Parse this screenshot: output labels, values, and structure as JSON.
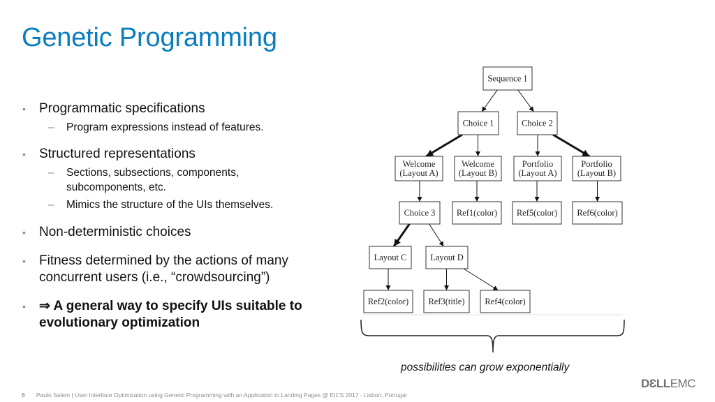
{
  "slide": {
    "title": "Genetic Programming",
    "page_number": "6",
    "footer": "Paulo Salem | User Interface Optimization using Genetic Programming with an Application to Landing Pages  @  EICS 2017 - Lisbon, Portugal",
    "logo": {
      "dell": "DƐLL",
      "emc": "EMC"
    },
    "accent_color": "#0a7dbd"
  },
  "bullets": [
    {
      "text": "Programmatic specifications",
      "sub": [
        "Program expressions instead of features."
      ]
    },
    {
      "text": "Structured representations",
      "sub": [
        "Sections, subsections, components, subcomponents, etc.",
        "Mimics the structure of the UIs themselves."
      ]
    },
    {
      "text": "Non-deterministic choices",
      "sub": []
    },
    {
      "text": "Fitness determined by the actions of many concurrent users (i.e., “crowdsourcing”)",
      "sub": []
    },
    {
      "text": "⇒ A general way to specify UIs suitable to evolutionary optimization",
      "sub": [],
      "bold": true
    }
  ],
  "bullet_glyph": "•",
  "sub_bullet_glyph": "–",
  "diagram": {
    "nodes": {
      "seq1": [
        "Sequence 1"
      ],
      "choice1": [
        "Choice 1"
      ],
      "choice2": [
        "Choice 2"
      ],
      "welcomeA": [
        "Welcome",
        "(Layout A)"
      ],
      "welcomeB": [
        "Welcome",
        "(Layout B)"
      ],
      "portfolioA": [
        "Portfolio",
        "(Layout A)"
      ],
      "portfolioB": [
        "Portfolio",
        "(Layout B)"
      ],
      "choice3": [
        "Choice 3"
      ],
      "ref1": [
        "Ref1(color)"
      ],
      "ref5": [
        "Ref5(color)"
      ],
      "ref6": [
        "Ref6(color)"
      ],
      "layoutC": [
        "Layout C"
      ],
      "layoutD": [
        "Layout D"
      ],
      "ref2": [
        "Ref2(color)"
      ],
      "ref3": [
        "Ref3(title)"
      ],
      "ref4": [
        "Ref4(color)"
      ]
    },
    "edges": [
      {
        "from": "seq1",
        "to": "choice1",
        "bold": false
      },
      {
        "from": "seq1",
        "to": "choice2",
        "bold": false
      },
      {
        "from": "choice1",
        "to": "welcomeA",
        "bold": true
      },
      {
        "from": "choice1",
        "to": "welcomeB",
        "bold": false
      },
      {
        "from": "choice2",
        "to": "portfolioA",
        "bold": false
      },
      {
        "from": "choice2",
        "to": "portfolioB",
        "bold": true
      },
      {
        "from": "welcomeA",
        "to": "choice3",
        "bold": false
      },
      {
        "from": "welcomeB",
        "to": "ref1",
        "bold": false
      },
      {
        "from": "portfolioA",
        "to": "ref5",
        "bold": false
      },
      {
        "from": "portfolioB",
        "to": "ref6",
        "bold": false
      },
      {
        "from": "choice3",
        "to": "layoutC",
        "bold": true
      },
      {
        "from": "choice3",
        "to": "layoutD",
        "bold": false
      },
      {
        "from": "layoutC",
        "to": "ref2",
        "bold": false
      },
      {
        "from": "layoutD",
        "to": "ref3",
        "bold": false
      },
      {
        "from": "layoutD",
        "to": "ref4",
        "bold": false
      }
    ],
    "caption": "possibilities can grow exponentially"
  }
}
